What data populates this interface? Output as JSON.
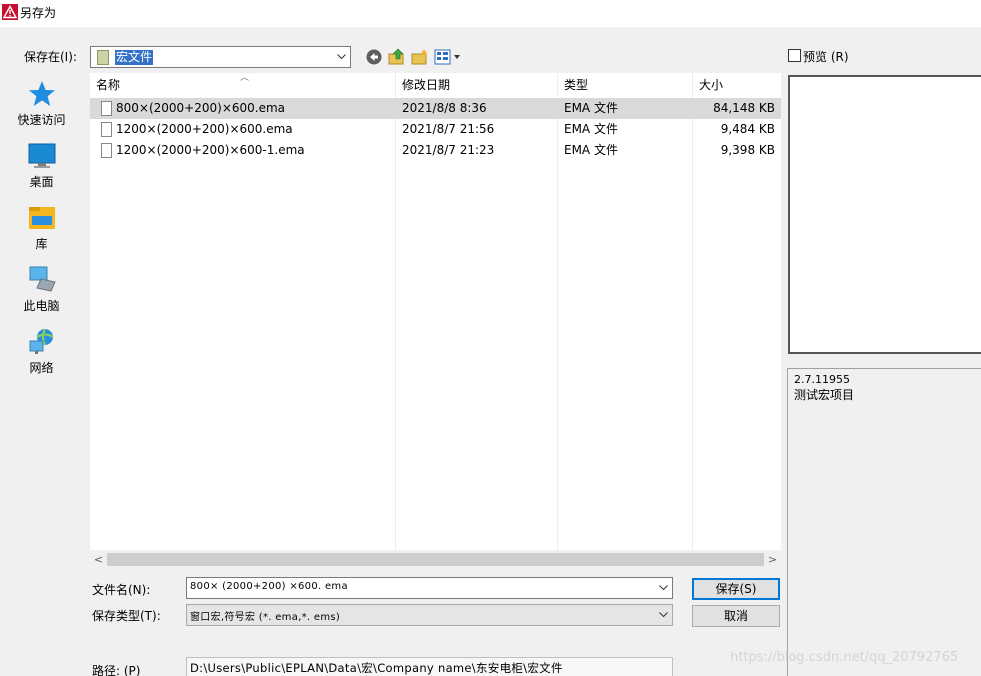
{
  "window": {
    "title": "另存为",
    "accent": "#c8102e"
  },
  "toolbar": {
    "save_in_label": "保存在(I):",
    "current_folder": "宏文件",
    "buttons": [
      {
        "icon": "back-icon"
      },
      {
        "icon": "up-folder-icon"
      },
      {
        "icon": "new-folder-icon"
      },
      {
        "icon": "view-menu-icon"
      }
    ]
  },
  "places": [
    {
      "label": "快速访问",
      "icon": "quick-access-star-icon"
    },
    {
      "label": "桌面",
      "icon": "desktop-icon"
    },
    {
      "label": "库",
      "icon": "libraries-icon"
    },
    {
      "label": "此电脑",
      "icon": "this-pc-icon"
    },
    {
      "label": "网络",
      "icon": "network-icon"
    }
  ],
  "columns": {
    "name": "名称",
    "modified": "修改日期",
    "type": "类型",
    "size": "大小"
  },
  "files": [
    {
      "name": "800×(2000+200)×600.ema",
      "modified": "2021/8/8 8:36",
      "type": "EMA 文件",
      "size": "84,148 KB",
      "selected": true
    },
    {
      "name": "1200×(2000+200)×600.ema",
      "modified": "2021/8/7 21:56",
      "type": "EMA 文件",
      "size": "9,484 KB",
      "selected": false
    },
    {
      "name": "1200×(2000+200)×600-1.ema",
      "modified": "2021/8/7 21:23",
      "type": "EMA 文件",
      "size": "9,398 KB",
      "selected": false
    }
  ],
  "form": {
    "filename_label": "文件名(N):",
    "filename_value": "800× (2000+200) ×600. ema",
    "filetype_label": "保存类型(T):",
    "filetype_value": "窗口宏,符号宏 (*. ema,*. ems)",
    "path_label": "路径: (P)",
    "path_value": "D:\\Users\\Public\\EPLAN\\Data\\宏\\Company name\\东安电柜\\宏文件"
  },
  "buttons": {
    "save": "保存(S)",
    "cancel": "取消"
  },
  "preview": {
    "checkbox_label": "预览 (R)",
    "checked": false,
    "version": "2.7.11955",
    "description": "测试宏项目"
  },
  "watermark": "https://blog.csdn.net/qq_20792765"
}
